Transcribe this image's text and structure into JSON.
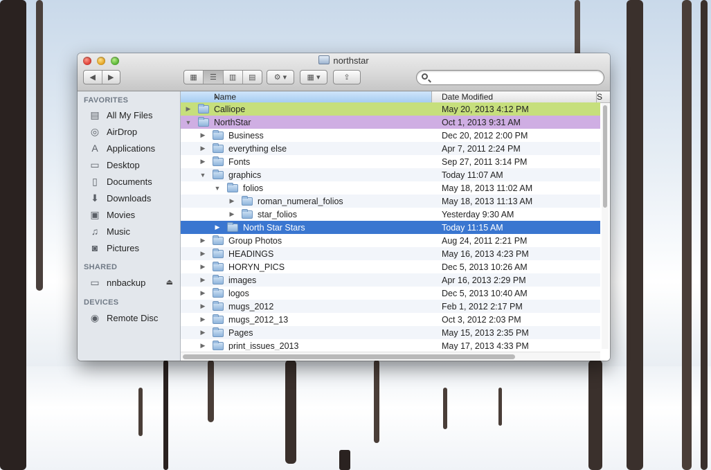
{
  "window": {
    "title": "northstar"
  },
  "toolbar": {
    "back_label": "◀",
    "forward_label": "▶",
    "view_icons": "▦",
    "view_list": "☰",
    "view_columns": "▥",
    "view_coverflow": "▤",
    "action_label": "⚙ ▾",
    "arrange_label": "▦ ▾",
    "share_label": "⇪",
    "search_placeholder": ""
  },
  "sidebar": {
    "favorites_header": "FAVORITES",
    "favorites": [
      {
        "label": "All My Files",
        "icon": "all-files-icon"
      },
      {
        "label": "AirDrop",
        "icon": "airdrop-icon"
      },
      {
        "label": "Applications",
        "icon": "applications-icon"
      },
      {
        "label": "Desktop",
        "icon": "desktop-icon"
      },
      {
        "label": "Documents",
        "icon": "documents-icon"
      },
      {
        "label": "Downloads",
        "icon": "downloads-icon"
      },
      {
        "label": "Movies",
        "icon": "movies-icon"
      },
      {
        "label": "Music",
        "icon": "music-icon"
      },
      {
        "label": "Pictures",
        "icon": "pictures-icon"
      }
    ],
    "shared_header": "SHARED",
    "shared": [
      {
        "label": "nnbackup",
        "icon": "server-icon"
      }
    ],
    "devices_header": "DEVICES",
    "devices": [
      {
        "label": "Remote Disc",
        "icon": "disc-icon"
      }
    ]
  },
  "columns": {
    "name": "Name",
    "date": "Date Modified",
    "size": "S"
  },
  "rows": [
    {
      "name": "Calliope",
      "date": "May 20, 2013 4:12 PM",
      "level": 0,
      "expanded": false,
      "label_color": "green"
    },
    {
      "name": "NorthStar",
      "date": "Oct 1, 2013 9:31 AM",
      "level": 0,
      "expanded": true,
      "label_color": "purple"
    },
    {
      "name": "Business",
      "date": "Dec 20, 2012 2:00 PM",
      "level": 1,
      "expanded": false
    },
    {
      "name": "everything else",
      "date": "Apr 7, 2011 2:24 PM",
      "level": 1,
      "expanded": false
    },
    {
      "name": "Fonts",
      "date": "Sep 27, 2011 3:14 PM",
      "level": 1,
      "expanded": false
    },
    {
      "name": "graphics",
      "date": "Today 11:07 AM",
      "level": 1,
      "expanded": true
    },
    {
      "name": "folios",
      "date": "May 18, 2013 11:02 AM",
      "level": 2,
      "expanded": true
    },
    {
      "name": "roman_numeral_folios",
      "date": "May 18, 2013 11:13 AM",
      "level": 3,
      "expanded": false
    },
    {
      "name": "star_folios",
      "date": "Yesterday 9:30 AM",
      "level": 3,
      "expanded": false
    },
    {
      "name": "North Star Stars",
      "date": "Today 11:15 AM",
      "level": 2,
      "expanded": false,
      "selected": true
    },
    {
      "name": "Group Photos",
      "date": "Aug 24, 2011 2:21 PM",
      "level": 1,
      "expanded": false
    },
    {
      "name": "HEADINGS",
      "date": "May 16, 2013 4:23 PM",
      "level": 1,
      "expanded": false
    },
    {
      "name": "HORYN_PICS",
      "date": "Dec 5, 2013 10:26 AM",
      "level": 1,
      "expanded": false
    },
    {
      "name": "images",
      "date": "Apr 16, 2013 2:29 PM",
      "level": 1,
      "expanded": false
    },
    {
      "name": "logos",
      "date": "Dec 5, 2013 10:40 AM",
      "level": 1,
      "expanded": false
    },
    {
      "name": "mugs_2012",
      "date": "Feb 1, 2012 2:17 PM",
      "level": 1,
      "expanded": false
    },
    {
      "name": "mugs_2012_13",
      "date": "Oct 3, 2012 2:03 PM",
      "level": 1,
      "expanded": false
    },
    {
      "name": "Pages",
      "date": "May 15, 2013 2:35 PM",
      "level": 1,
      "expanded": false
    },
    {
      "name": "print_issues_2013",
      "date": "May 17, 2013 4:33 PM",
      "level": 1,
      "expanded": false
    }
  ],
  "colors": {
    "selection": "#3a76d0",
    "label_green": "#c6df7c",
    "label_purple": "#cfaee3"
  }
}
